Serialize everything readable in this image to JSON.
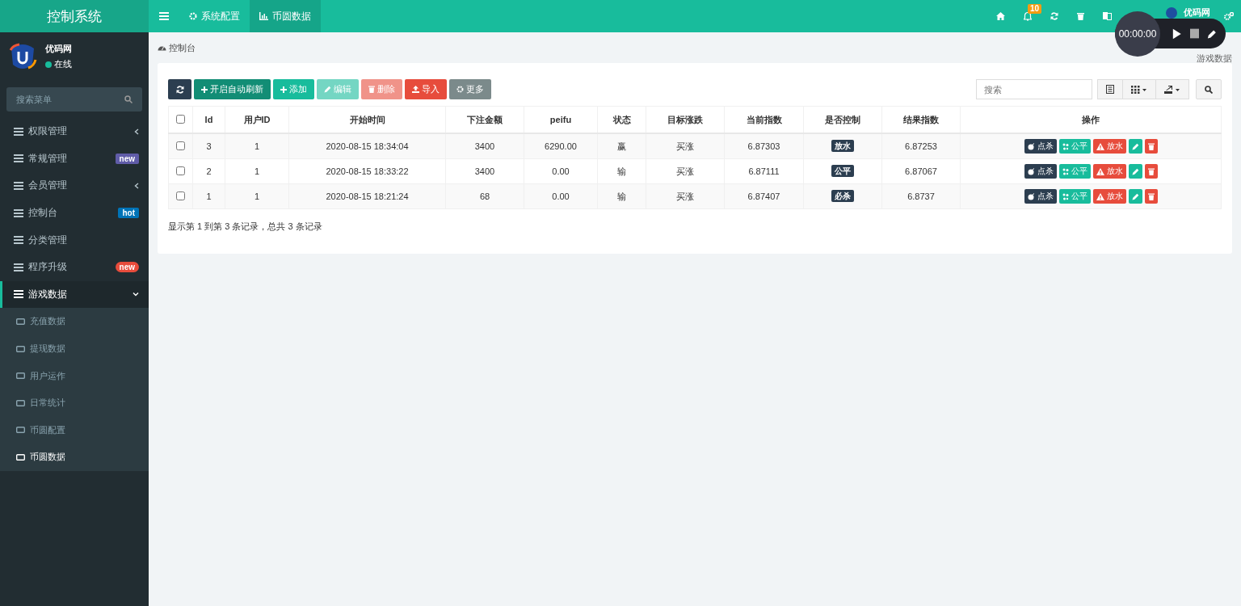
{
  "brand": {
    "title": "控制系统"
  },
  "topbar": {
    "tabs": [
      {
        "label": "系统配置",
        "selected": false
      },
      {
        "label": "币圆数据",
        "selected": true
      }
    ],
    "notification_count": "10",
    "user_name": "优码网"
  },
  "recorder": {
    "time": "00:00:00"
  },
  "user_panel": {
    "name": "优码网",
    "status": "在线"
  },
  "sidebar_search": {
    "placeholder": "搜索菜单"
  },
  "sidebar": {
    "items": [
      {
        "label": "权限管理",
        "collapsible": true,
        "expanded": false
      },
      {
        "label": "常规管理",
        "badge": "new",
        "color": "#605ca8",
        "pill": false,
        "collapsible": false,
        "expanded": false
      },
      {
        "label": "会员管理",
        "collapsible": true,
        "expanded": false
      },
      {
        "label": "控制台",
        "badge": "hot",
        "color": "#0073b7",
        "pill": false,
        "collapsible": false,
        "expanded": false
      },
      {
        "label": "分类管理",
        "collapsible": false,
        "expanded": false
      },
      {
        "label": "程序升级",
        "badge": "new",
        "color": "#e74c3c",
        "pill": true,
        "collapsible": false,
        "expanded": false
      },
      {
        "label": "游戏数据",
        "collapsible": true,
        "expanded": true,
        "children": [
          {
            "label": "充值数据",
            "selected": false
          },
          {
            "label": "提现数据",
            "selected": false
          },
          {
            "label": "用户运作",
            "selected": false
          },
          {
            "label": "日常统计",
            "selected": false
          },
          {
            "label": "币圆配置",
            "selected": false
          },
          {
            "label": "币圆数据",
            "selected": true
          }
        ]
      }
    ]
  },
  "breadcrumb": {
    "current": "控制台",
    "right": "游戏数据"
  },
  "toolbar": {
    "buttons": [
      {
        "kind": "refresh",
        "disabled": false
      },
      {
        "label": "开启自动刷新",
        "kind": "auto",
        "disabled": false
      },
      {
        "label": "添加",
        "kind": "add",
        "disabled": false
      },
      {
        "label": "编辑",
        "kind": "edit",
        "disabled": true
      },
      {
        "label": "删除",
        "kind": "delete",
        "disabled": true
      },
      {
        "label": "导入",
        "kind": "import",
        "disabled": false
      },
      {
        "label": "更多",
        "kind": "more",
        "disabled": false
      }
    ],
    "search_placeholder": "搜索"
  },
  "table": {
    "header_checked": false,
    "columns": [
      "Id",
      "用户ID",
      "开始时间",
      "下注金额",
      "peifu",
      "状态",
      "目标涨跌",
      "当前指数",
      "是否控制",
      "结果指数",
      "操作"
    ],
    "rows": [
      {
        "checked": false,
        "cells": [
          "3",
          "1",
          "2020-08-15 18:34:04",
          "3400",
          "6290.00",
          "赢",
          "买涨",
          "6.87303"
        ],
        "control": "放水",
        "result": "6.87253",
        "actions": [
          {
            "label": "点杀",
            "kind": "dark"
          },
          {
            "label": "公平",
            "kind": "green"
          },
          {
            "label": "放水",
            "kind": "red"
          },
          {
            "kind": "edit"
          },
          {
            "kind": "delete"
          }
        ]
      },
      {
        "checked": false,
        "cells": [
          "2",
          "1",
          "2020-08-15 18:33:22",
          "3400",
          "0.00",
          "输",
          "买涨",
          "6.87111"
        ],
        "control": "公平",
        "result": "6.87067",
        "actions": [
          {
            "label": "点杀",
            "kind": "dark"
          },
          {
            "label": "公平",
            "kind": "green"
          },
          {
            "label": "放水",
            "kind": "red"
          },
          {
            "kind": "edit"
          },
          {
            "kind": "delete"
          }
        ]
      },
      {
        "checked": false,
        "cells": [
          "1",
          "1",
          "2020-08-15 18:21:24",
          "68",
          "0.00",
          "输",
          "买涨",
          "6.87407"
        ],
        "control": "必杀",
        "result": "6.8737",
        "actions": [
          {
            "label": "点杀",
            "kind": "dark"
          },
          {
            "label": "公平",
            "kind": "green"
          },
          {
            "label": "放水",
            "kind": "red"
          },
          {
            "kind": "edit"
          },
          {
            "kind": "delete"
          }
        ]
      }
    ],
    "summary": "显示第 1 到第 3 条记录，总共 3 条记录"
  }
}
